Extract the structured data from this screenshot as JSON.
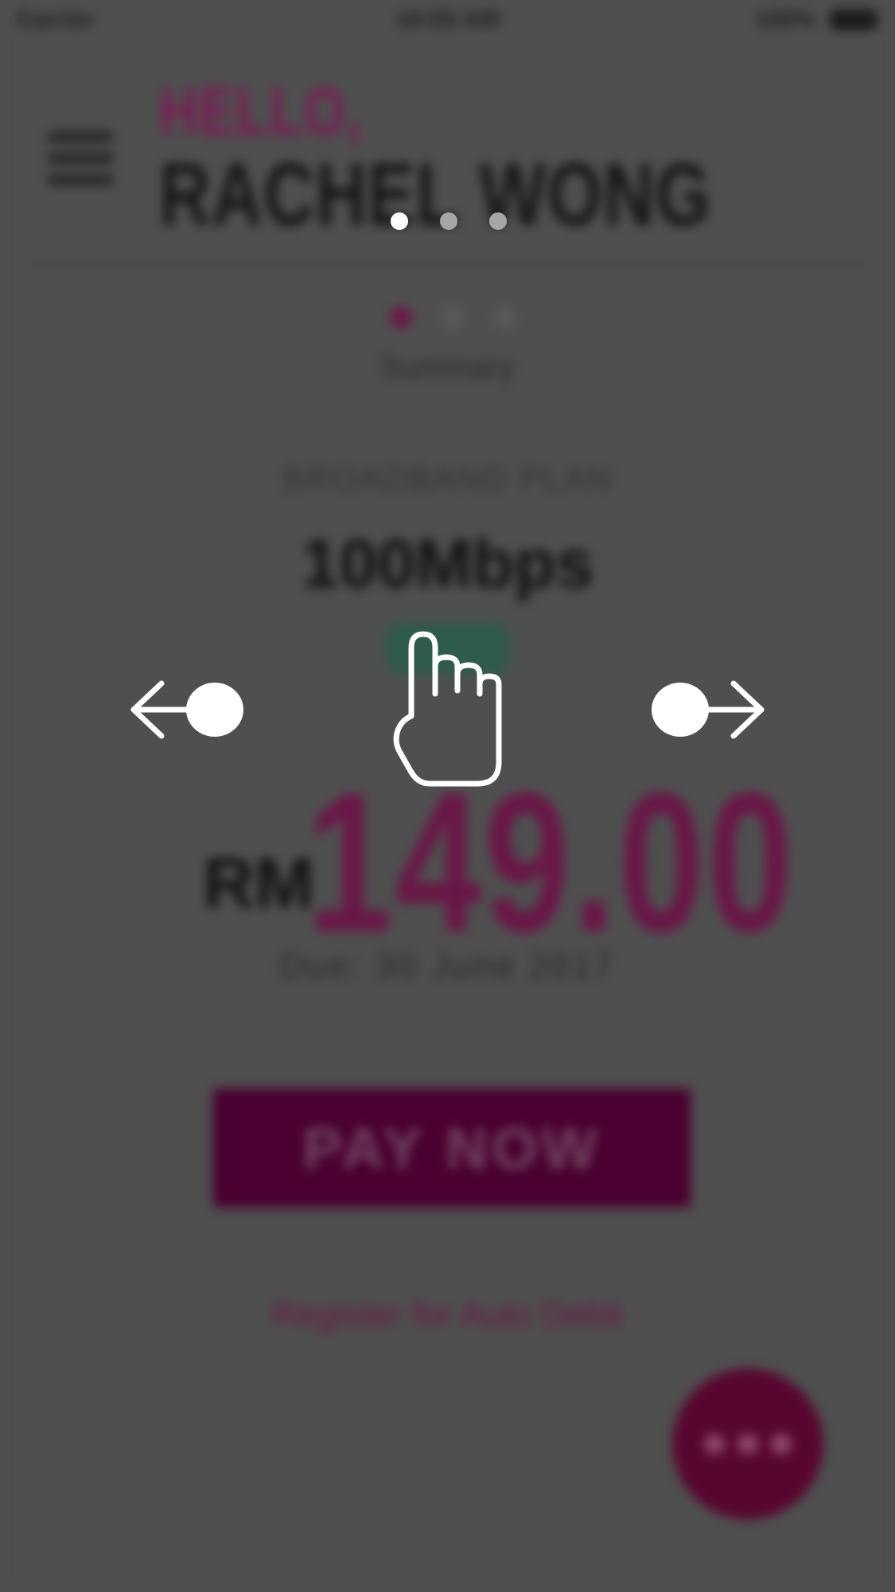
{
  "status_bar": {
    "carrier": "Carrier",
    "time": "10:55 AM",
    "battery_percent": "100%"
  },
  "header": {
    "greeting": "HELLO,",
    "user_name": "RACHEL WONG"
  },
  "onboarding": {
    "page_count": 3,
    "active_page": 0,
    "gesture_icon": "swipe-hand-icon",
    "left_arrow_icon": "swipe-left-arrow-icon",
    "right_arrow_icon": "swipe-right-arrow-icon"
  },
  "steps": {
    "label": "Summary"
  },
  "plan": {
    "caption": "BROADBAND PLAN",
    "speed": "100Mbps",
    "badge": "Active"
  },
  "price": {
    "currency": "RM",
    "amount": "149.00",
    "note": "Due: 30 June 2017"
  },
  "actions": {
    "pay_label": "PAY NOW",
    "register_label": "Register for Auto Debit",
    "fab_icon": "more-horizontal-icon"
  },
  "colors": {
    "accent": "#6a1747",
    "accent_dark": "#4a0030",
    "overlay": "#4e4e4e",
    "badge": "#2f5b4c",
    "white": "#ffffff"
  }
}
